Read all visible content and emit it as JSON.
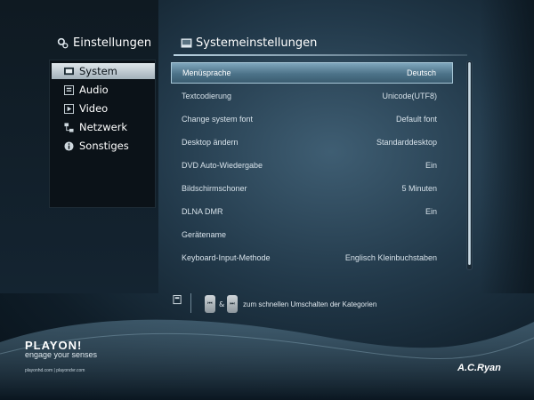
{
  "sidebar": {
    "title": "Einstellungen",
    "title_icon": "gear-icon",
    "items": [
      {
        "label": "System",
        "icon": "system-icon",
        "selected": true
      },
      {
        "label": "Audio",
        "icon": "audio-icon",
        "selected": false
      },
      {
        "label": "Video",
        "icon": "video-icon",
        "selected": false
      },
      {
        "label": "Netzwerk",
        "icon": "network-icon",
        "selected": false
      },
      {
        "label": "Sonstiges",
        "icon": "info-icon",
        "selected": false
      }
    ]
  },
  "main": {
    "title": "Systemeinstellungen",
    "title_icon": "system-icon",
    "rows": [
      {
        "label": "Menüsprache",
        "value": "Deutsch",
        "selected": true
      },
      {
        "label": "Textcodierung",
        "value": "Unicode(UTF8)",
        "selected": false
      },
      {
        "label": "Change system font",
        "value": "Default font",
        "selected": false
      },
      {
        "label": "Desktop ändern",
        "value": "Standarddesktop",
        "selected": false
      },
      {
        "label": "DVD Auto-Wiedergabe",
        "value": "Ein",
        "selected": false
      },
      {
        "label": "Bildschirmschoner",
        "value": "5 Minuten",
        "selected": false
      },
      {
        "label": "DLNA DMR",
        "value": "Ein",
        "selected": false
      },
      {
        "label": "Gerätename",
        "value": "",
        "selected": false
      },
      {
        "label": "Keyboard-Input-Methode",
        "value": "Englisch Kleinbuchstaben",
        "selected": false
      }
    ]
  },
  "hint": {
    "left_key": "⏮",
    "amp": "&",
    "right_key": "⏭",
    "text": "zum schnellen Umschalten der Kategorien"
  },
  "branding": {
    "logo": "PLAYON!",
    "tagline": "engage your senses",
    "urls": "playonhd.com | playondvr.com",
    "maker": "A.C.Ryan"
  },
  "colors": {
    "accent": "#5f8aa3",
    "selection_light": "#dfe6ea",
    "background_dark": "#0b1218"
  }
}
